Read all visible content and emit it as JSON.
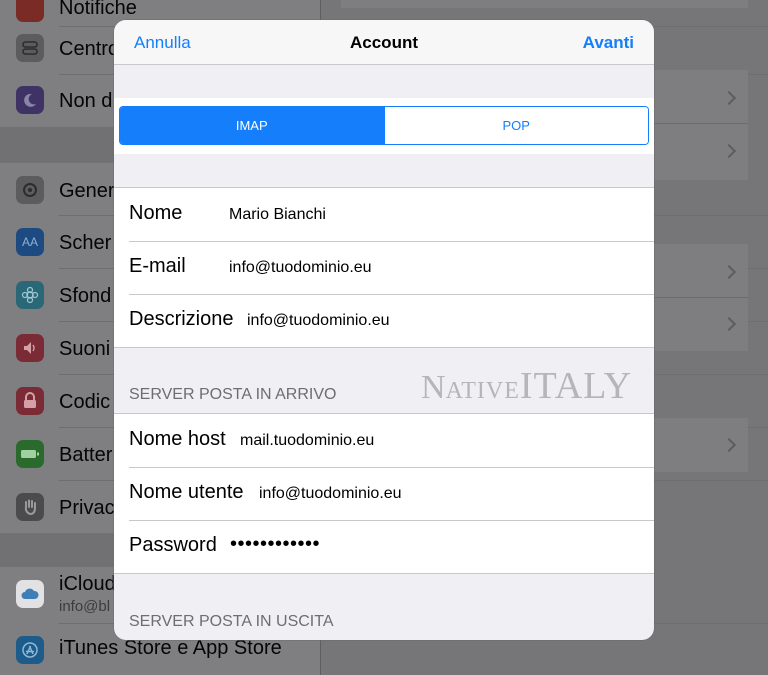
{
  "background": {
    "sidebar": {
      "items": [
        {
          "label": "Notifiche",
          "icon": "notifications-icon",
          "color": "#7a2b26"
        },
        {
          "label": "Centro",
          "icon": "control-center-icon",
          "color": "#5c5c5e"
        },
        {
          "label": "Non d",
          "icon": "moon-icon",
          "color": "#3f3366"
        },
        {
          "label": "Gener",
          "icon": "gear-icon",
          "color": "#5c5c5e"
        },
        {
          "label": "Scher",
          "icon": "text-size-icon",
          "color": "#1d4a80"
        },
        {
          "label": "Sfond",
          "icon": "wallpaper-icon",
          "color": "#2a6878"
        },
        {
          "label": "Suoni",
          "icon": "speaker-icon",
          "color": "#7a2b35"
        },
        {
          "label": "Codic",
          "icon": "lock-icon",
          "color": "#7a2b35"
        },
        {
          "label": "Batter",
          "icon": "battery-icon",
          "color": "#2a6a2d"
        },
        {
          "label": "Privac",
          "icon": "hand-icon",
          "color": "#4b4b4d"
        },
        {
          "label": "iCloud",
          "sublabel": "info@bl",
          "icon": "icloud-icon",
          "color": "#e2e2e4"
        },
        {
          "label": "iTunes Store e App Store",
          "icon": "app-store-icon",
          "color": "#1d5c8a"
        }
      ]
    }
  },
  "modal": {
    "nav": {
      "cancel": "Annulla",
      "title": "Account",
      "next": "Avanti"
    },
    "segmented": {
      "options": [
        "IMAP",
        "POP"
      ],
      "selected": "IMAP"
    },
    "account_fields": [
      {
        "label": "Nome",
        "value": "Mario Bianchi"
      },
      {
        "label": "E-mail",
        "value": "info@tuodominio.eu"
      },
      {
        "label": "Descrizione",
        "value": "info@tuodominio.eu"
      }
    ],
    "incoming": {
      "header": "SERVER POSTA IN ARRIVO",
      "fields": [
        {
          "label": "Nome host",
          "value": "mail.tuodominio.eu"
        },
        {
          "label": "Nome utente",
          "value": "info@tuodominio.eu"
        },
        {
          "label": "Password",
          "value": "••••••••••••"
        }
      ]
    },
    "outgoing": {
      "header": "SERVER POSTA IN USCITA"
    }
  },
  "watermark": {
    "part1": "N",
    "part2": "ATIVE",
    "part3": "ITALY"
  },
  "colors": {
    "accent": "#147efb",
    "group_background": "#efeff4",
    "separator": "#c8c7cc"
  }
}
